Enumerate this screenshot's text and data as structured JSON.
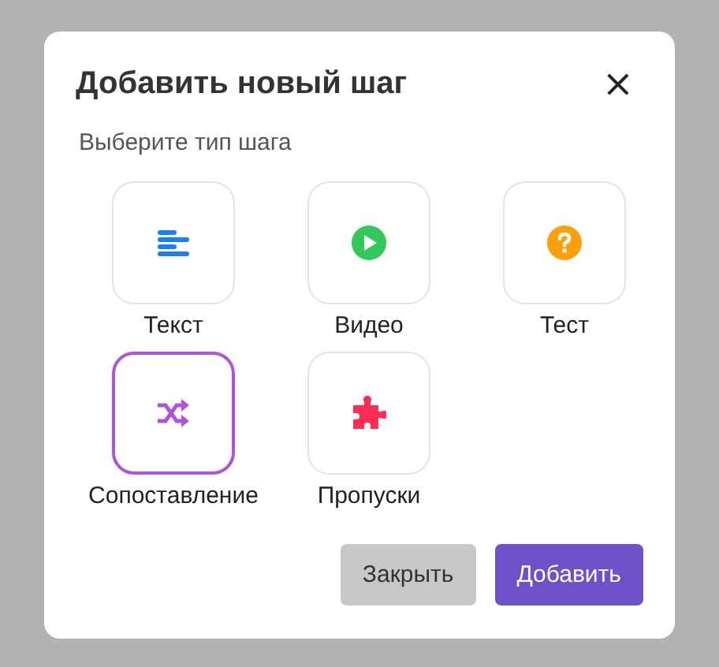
{
  "dialog": {
    "title": "Добавить новый шаг",
    "close": "×",
    "prompt": "Выберите тип шага"
  },
  "step_types": [
    {
      "kind": "text",
      "label": "Текст",
      "color": "#1a7ff0",
      "selected": false
    },
    {
      "kind": "video",
      "label": "Видео",
      "color": "#34c759",
      "selected": false
    },
    {
      "kind": "quiz",
      "label": "Тест",
      "color": "#ff9f0a",
      "selected": false
    },
    {
      "kind": "matching",
      "label": "Сопоставление",
      "color": "#af52de",
      "selected": true
    },
    {
      "kind": "gaps",
      "label": "Пропуски",
      "color": "#ff2d55",
      "selected": false
    }
  ],
  "buttons": [
    {
      "kind": "secondary",
      "label": "Закрыть"
    },
    {
      "kind": "primary",
      "label": "Добавить"
    }
  ]
}
